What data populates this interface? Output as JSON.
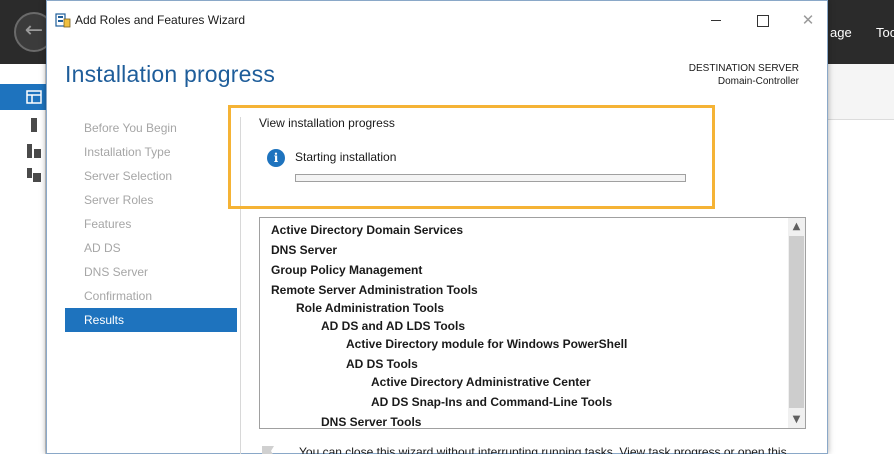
{
  "background_app": {
    "menu_items": [
      "age",
      "Too"
    ]
  },
  "window": {
    "title": "Add Roles and Features Wizard",
    "close_glyph": "✕"
  },
  "header": {
    "page_title": "Installation progress",
    "destination_label": "DESTINATION SERVER",
    "destination_value": "Domain-Controller"
  },
  "nav": {
    "items": [
      {
        "label": "Before You Begin",
        "active": false
      },
      {
        "label": "Installation Type",
        "active": false
      },
      {
        "label": "Server Selection",
        "active": false
      },
      {
        "label": "Server Roles",
        "active": false
      },
      {
        "label": "Features",
        "active": false
      },
      {
        "label": "AD DS",
        "active": false
      },
      {
        "label": "DNS Server",
        "active": false
      },
      {
        "label": "Confirmation",
        "active": false
      },
      {
        "label": "Results",
        "active": true
      }
    ]
  },
  "progress": {
    "section_label": "View installation progress",
    "status_text": "Starting installation",
    "percent": 0,
    "info_glyph": "i"
  },
  "features_list": {
    "items": [
      {
        "label": "Active Directory Domain Services",
        "level": 0
      },
      {
        "label": "DNS Server",
        "level": 0
      },
      {
        "label": "Group Policy Management",
        "level": 0
      },
      {
        "label": "Remote Server Administration Tools",
        "level": 0
      },
      {
        "label": "Role Administration Tools",
        "level": 1
      },
      {
        "label": "AD DS and AD LDS Tools",
        "level": 2
      },
      {
        "label": "Active Directory module for Windows PowerShell",
        "level": 3
      },
      {
        "label": "AD DS Tools",
        "level": 3
      },
      {
        "label": "Active Directory Administrative Center",
        "level": 4
      },
      {
        "label": "AD DS Snap-Ins and Command-Line Tools",
        "level": 4
      },
      {
        "label": "DNS Server Tools",
        "level": 2
      }
    ]
  },
  "scrollbar": {
    "up_glyph": "▲",
    "down_glyph": "▼"
  },
  "footer": {
    "note": "You can close this wizard without interrupting running tasks. View task progress or open this"
  },
  "colors": {
    "accent": "#1e73be",
    "title_blue": "#1e5d9a",
    "highlight": "#f5b335",
    "progress_green": "#06b025"
  }
}
